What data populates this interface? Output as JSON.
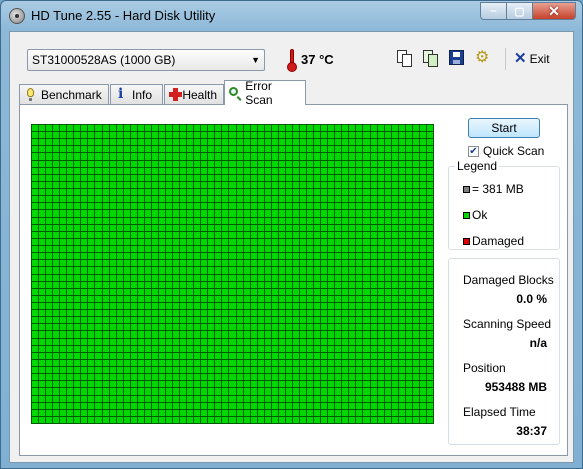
{
  "window": {
    "title": "HD Tune 2.55 - Hard Disk Utility",
    "caption": {
      "minimize": "–",
      "maximize": "▢",
      "close": "✕"
    }
  },
  "toolbar": {
    "drive": "ST31000528AS (1000 GB)",
    "temperature": "37 °C",
    "exit_label": "Exit"
  },
  "tabs": [
    {
      "label": "Benchmark",
      "icon": "bulb-icon"
    },
    {
      "label": "Info",
      "icon": "info-icon"
    },
    {
      "label": "Health",
      "icon": "health-cross-icon"
    },
    {
      "label": "Error Scan",
      "icon": "magnifier-icon",
      "active": true
    }
  ],
  "scan": {
    "columns": 57,
    "rows": 42,
    "status_color": "#00d800",
    "start_label": "Start",
    "quick_scan_label": "Quick Scan",
    "quick_scan_checked": true
  },
  "legend": {
    "title": "Legend",
    "items": [
      {
        "label": "= 381 MB",
        "color": "#808080"
      },
      {
        "label": "Ok",
        "color": "#00d800"
      },
      {
        "label": "Damaged",
        "color": "#e00000"
      }
    ]
  },
  "stats": {
    "damaged_blocks_label": "Damaged Blocks",
    "damaged_blocks_value": "0.0 %",
    "scanning_speed_label": "Scanning Speed",
    "scanning_speed_value": "n/a",
    "position_label": "Position",
    "position_value": "953488 MB",
    "elapsed_time_label": "Elapsed Time",
    "elapsed_time_value": "38:37"
  }
}
